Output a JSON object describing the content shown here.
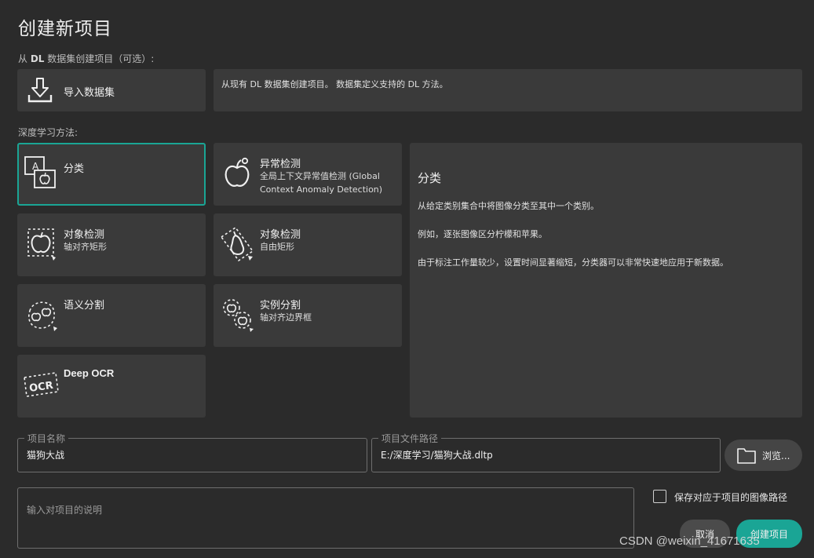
{
  "dialog": {
    "title": "创建新项目"
  },
  "dataset_section": {
    "label_prefix": "从 ",
    "label_bold": "DL",
    "label_suffix": " 数据集创建项目（可选）:",
    "import_button": "导入数据集",
    "import_icon": "download-icon",
    "description": "从现有 DL 数据集创建项目。 数据集定义支持的 DL 方法。"
  },
  "methods_section": {
    "label": "深度学习方法:",
    "methods": [
      {
        "title": "分类",
        "subtitle": "",
        "icon": "classification-icon",
        "selected": true
      },
      {
        "title": "异常检测",
        "subtitle": "全局上下文异常值检测 (Global Context Anomaly Detection)",
        "icon": "anomaly-detection-icon",
        "selected": false
      },
      {
        "title": "对象检测",
        "subtitle": "轴对齐矩形",
        "icon": "object-detection-axis-aligned-icon",
        "selected": false
      },
      {
        "title": "对象检测",
        "subtitle": "自由矩形",
        "icon": "object-detection-oriented-icon",
        "selected": false
      },
      {
        "title": "语义分割",
        "subtitle": "",
        "icon": "semantic-segmentation-icon",
        "selected": false
      },
      {
        "title": "实例分割",
        "subtitle": "轴对齐边界框",
        "icon": "instance-segmentation-icon",
        "selected": false
      },
      {
        "title": "Deep OCR",
        "subtitle": "",
        "icon": "ocr-icon",
        "selected": false
      }
    ]
  },
  "method_description": {
    "title": "分类",
    "paragraphs": [
      "从给定类别集合中将图像分类至其中一个类别。",
      "例如，逐张图像区分柠檬和苹果。",
      "由于标注工作量较少，设置时间显著缩短，分类器可以非常快速地应用于新数据。"
    ]
  },
  "project_name": {
    "legend": "项目名称",
    "value": "猫狗大战"
  },
  "project_path": {
    "legend": "项目文件路径",
    "value": "E:/深度学习/猫狗大战.dltp"
  },
  "browse_button": {
    "label": "浏览...",
    "icon": "folder-icon"
  },
  "description_input": {
    "placeholder": "输入对项目的说明",
    "value": ""
  },
  "save_image_paths": {
    "label": "保存对应于项目的图像路径",
    "checked": false
  },
  "buttons": {
    "cancel": "取消",
    "create": "创建项目"
  },
  "colors": {
    "accent": "#1aa595",
    "background": "#2b2b2b",
    "panel": "#3a3a3a"
  },
  "watermark": "CSDN @weixin_41671635"
}
